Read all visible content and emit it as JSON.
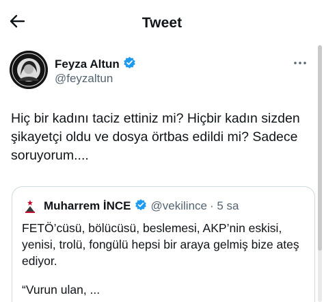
{
  "header": {
    "title": "Tweet",
    "back_icon": "arrow-left-icon"
  },
  "tweet": {
    "author_name": "Feyza Altun",
    "author_handle": "@feyzaltun",
    "verified_icon": "verified-badge-icon",
    "text": "Hiç bir kadını taciz ettiniz mi? Hiçbir kadın sizden şikayetçi oldu ve dosya örtbas edildi mi? Sadece soruyorum....",
    "more_icon": "more-options-icon"
  },
  "quoted_tweet": {
    "author_name": "Muharrem İNCE",
    "author_handle": "@vekilince",
    "time": "· 5 sa",
    "text": "FETÖ’cüsü, bölücüsü, beslemesi, AKP’nin eskisi, yenisi, trolü, fongülü hepsi bir araya gelmiş bize ateş ediyor.",
    "text_2": "“Vurun ulan, ..."
  },
  "colors": {
    "verified": "#1d9bf0",
    "secondary_text": "#536471",
    "border": "#cfd9de"
  }
}
